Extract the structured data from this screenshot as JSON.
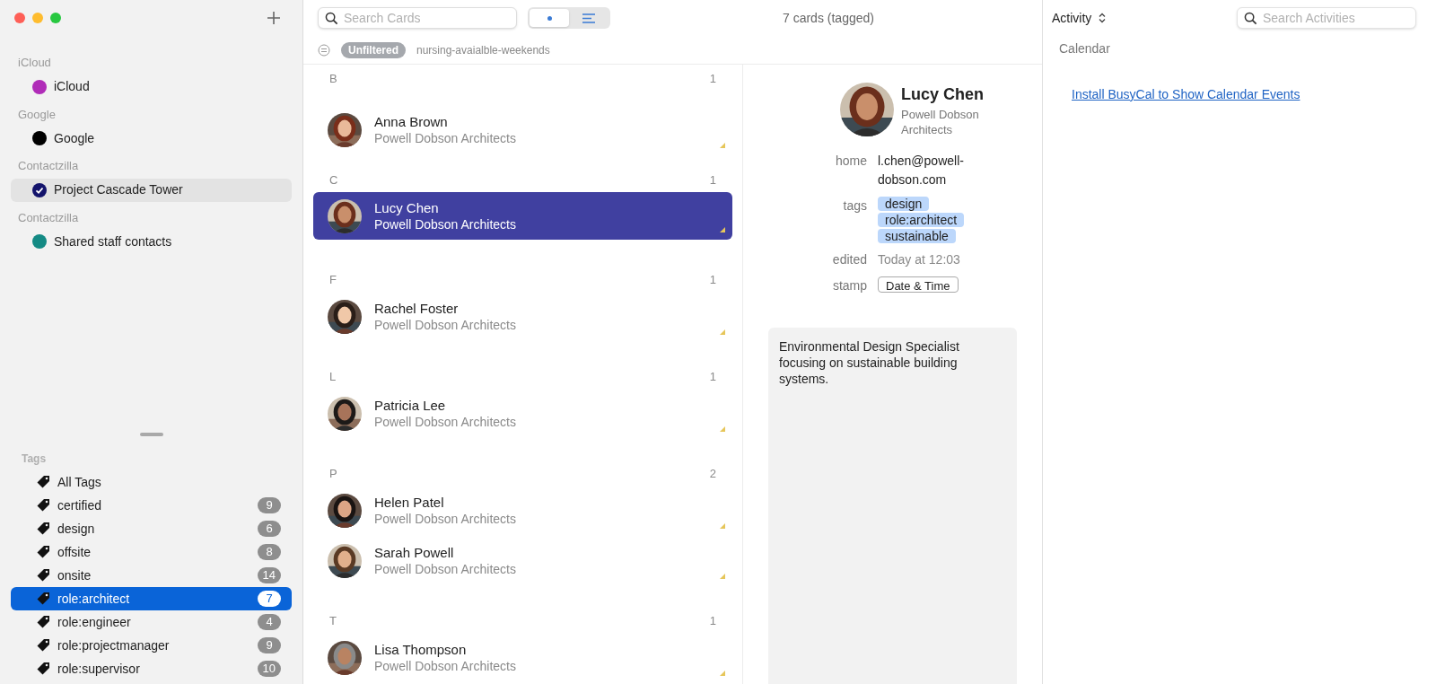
{
  "sidebar": {
    "accounts": [
      {
        "group": "iCloud",
        "name": "iCloud",
        "color": "#b02cb8",
        "selected": false
      },
      {
        "group": "Google",
        "name": "Google",
        "color": "#000000",
        "selected": false
      },
      {
        "group": "Contactzilla",
        "name": "Project Cascade Tower",
        "color": "#13136b",
        "selected": true
      },
      {
        "group": "Contactzilla",
        "name": "Shared staff contacts",
        "color": "#148a84",
        "selected": false
      }
    ],
    "tags_heading": "Tags",
    "tags": [
      {
        "label": "All Tags",
        "selected": false
      },
      {
        "label": "certified",
        "count": "9",
        "selected": false
      },
      {
        "label": "design",
        "count": "6",
        "selected": false
      },
      {
        "label": "offsite",
        "count": "8",
        "selected": false
      },
      {
        "label": "onsite",
        "count": "14",
        "selected": false
      },
      {
        "label": "role:architect",
        "count": "7",
        "selected": true
      },
      {
        "label": "role:engineer",
        "count": "4",
        "selected": false
      },
      {
        "label": "role:projectmanager",
        "count": "9",
        "selected": false
      },
      {
        "label": "role:supervisor",
        "count": "10",
        "selected": false
      }
    ]
  },
  "toolbar": {
    "search": {
      "placeholder": "Search Cards"
    },
    "view_toggle": [
      {
        "kind": "dot",
        "selected": true
      },
      {
        "kind": "lines",
        "selected": false
      }
    ],
    "card_count": "7 cards (tagged)"
  },
  "filter": {
    "badge": "Unfiltered",
    "name": "nursing-avaialble-weekends"
  },
  "card_sections": [
    {
      "letter": "B",
      "count": "1",
      "cards": [
        {
          "name": "Anna Brown",
          "company": "Powell Dobson Architects",
          "selected": false
        }
      ]
    },
    {
      "letter": "C",
      "count": "1",
      "cards": [
        {
          "name": "Lucy Chen",
          "company": "Powell Dobson Architects",
          "selected": true
        }
      ]
    },
    {
      "letter": "F",
      "count": "1",
      "cards": [
        {
          "name": "Rachel Foster",
          "company": "Powell Dobson Architects",
          "selected": false
        }
      ]
    },
    {
      "letter": "L",
      "count": "1",
      "cards": [
        {
          "name": "Patricia Lee",
          "company": "Powell Dobson Architects",
          "selected": false
        }
      ]
    },
    {
      "letter": "P",
      "count": "2",
      "cards": [
        {
          "name": "Helen Patel",
          "company": "Powell Dobson Architects",
          "selected": false
        },
        {
          "name": "Sarah Powell",
          "company": "Powell Dobson Architects",
          "selected": false
        }
      ]
    },
    {
      "letter": "T",
      "count": "1",
      "cards": [
        {
          "name": "Lisa Thompson",
          "company": "Powell Dobson Architects",
          "selected": false
        }
      ]
    }
  ],
  "detail": {
    "name": "Lucy Chen",
    "company": "Powell Dobson Architects",
    "fields": [
      {
        "kind": "text",
        "label": "home",
        "value": "l.chen@powell-dobson.com"
      },
      {
        "kind": "tags",
        "label": "tags",
        "values": [
          "design",
          "role:architect",
          "sustainable"
        ]
      },
      {
        "kind": "muted",
        "label": "edited",
        "value": "Today at 12:03"
      },
      {
        "kind": "button",
        "label": "stamp",
        "value": "Date & Time"
      }
    ],
    "note": "Environmental Design Specialist focusing on sustainable building systems."
  },
  "activity": {
    "menu": "Activity",
    "search": {
      "placeholder": "Search Activities"
    },
    "section": "Calendar",
    "link": "Install BusyCal to Show Calendar Events"
  }
}
